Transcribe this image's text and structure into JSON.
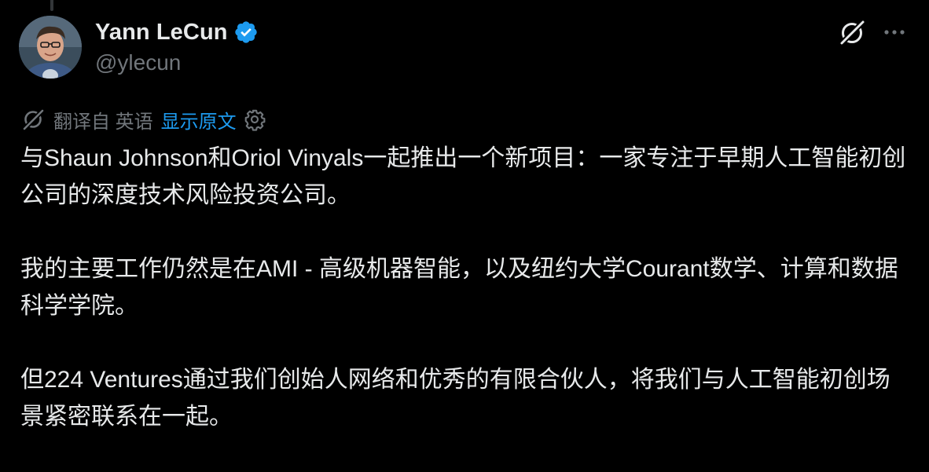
{
  "author": {
    "display_name": "Yann LeCun",
    "handle": "@ylecun",
    "verified": true,
    "verified_color": "#1d9bf0"
  },
  "header_actions": {
    "grok_icon": "grok-slash-circle-icon",
    "more_icon": "more-horizontal-icon"
  },
  "translation": {
    "icon": "translate-icon",
    "translated_from": "翻译自 英语",
    "show_original": "显示原文",
    "settings_icon": "gear-icon",
    "link_color": "#1d9bf0"
  },
  "tweet": {
    "paragraphs": [
      "与Shaun Johnson和Oriol Vinyals一起推出一个新项目：一家专注于早期人工智能初创公司的深度技术风险投资公司。",
      "我的主要工作仍然是在AMI - 高级机器智能，以及纽约大学Courant数学、计算和数据科学学院。",
      "但224 Ventures通过我们创始人网络和优秀的有限合伙人，将我们与人工智能初创场景紧密联系在一起。"
    ]
  },
  "colors": {
    "background": "#000000",
    "primary_text": "#e7e9ea",
    "secondary_text": "#71767b",
    "accent": "#1d9bf0"
  }
}
